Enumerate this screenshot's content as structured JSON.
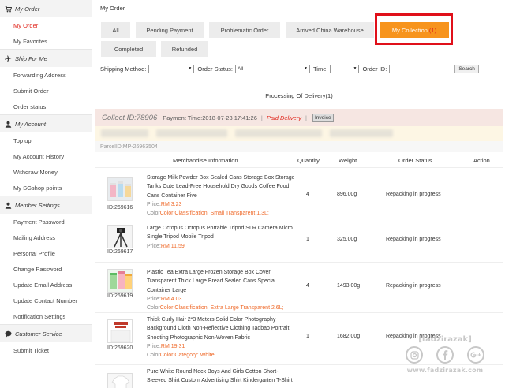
{
  "sidebar": {
    "sections": [
      {
        "heading": "My Order",
        "icon": "cart-icon",
        "items": [
          "My Order",
          "My Favorites"
        ]
      },
      {
        "heading": "Ship For Me",
        "icon": "plane-icon",
        "items": [
          "Forwarding Address",
          "Submit Order",
          "Order status"
        ]
      },
      {
        "heading": "My Account",
        "icon": "user-icon",
        "items": [
          "Top up",
          "My Account History",
          "Withdraw Money",
          "My SGshop points"
        ]
      },
      {
        "heading": "Member Settings",
        "icon": "user-icon",
        "items": [
          "Payment Password",
          "Mailing Address",
          "Personal Profile",
          "Change Password",
          "Update Email Address",
          "Update Contact Number",
          "Notification Settings"
        ]
      },
      {
        "heading": "Customer Service",
        "icon": "chat-icon",
        "items": [
          "Submit Ticket"
        ]
      }
    ]
  },
  "page": {
    "title": "My Order"
  },
  "tabs": [
    {
      "label": "All"
    },
    {
      "label": "Pending Payment"
    },
    {
      "label": "Problematic Order"
    },
    {
      "label": "Arrived China Warehouse"
    },
    {
      "label": "My Collection",
      "count": "(1)"
    },
    {
      "label": "Completed"
    },
    {
      "label": "Refunded"
    }
  ],
  "filters": {
    "shipping_label": "Shipping Method:",
    "shipping_value": "--",
    "status_label": "Order Status:",
    "status_value": "All",
    "time_label": "Time:",
    "time_value": "--",
    "orderid_label": "Order ID:",
    "search_label": "Search"
  },
  "processing_title": "Processing Of Delivery(1)",
  "collect": {
    "id": "Collect ID:78906",
    "payment_time": "Payment Time:2018-07-23 17:41:26",
    "separator": "|",
    "status": "Paid Delivery",
    "invoice_label": "Invoice",
    "parcel_id": "ParcelID:MP-26963504"
  },
  "table": {
    "headers": [
      "Merchandise Information",
      "Quantity",
      "Weight",
      "Order Status",
      "Action"
    ],
    "rows": [
      {
        "id": "ID:269616",
        "title": "Storage Milk Powder Box Sealed Cans Storage Box Storage Tanks Cute Lead-Free Household Dry Goods Coffee Food Cans Container Five",
        "price_label": "Price:",
        "price": "RM 3.23",
        "color_label": "Color",
        "color_value": "Color Classification: Small Transparent 1.3L;",
        "quantity": "4",
        "weight": "896.00g",
        "status": "Repacking in progress"
      },
      {
        "id": "ID:269617",
        "title": "Large Octopus Octopus Portable Tripod SLR Camera Micro Single Tripod Mobile Tripod",
        "price_label": "Price:",
        "price": "RM 11.59",
        "color_label": "",
        "color_value": "",
        "quantity": "1",
        "weight": "325.00g",
        "status": "Repacking in progress"
      },
      {
        "id": "ID:269619",
        "title": "Plastic Tea Extra Large Frozen Storage Box Cover Transparent Thick Large Bread Sealed Cans Special Container Large",
        "price_label": "Price:",
        "price": "RM 4.03",
        "color_label": "Color",
        "color_value": "Color Classification: Extra Large Transparent 2.6L;",
        "quantity": "4",
        "weight": "1493.00g",
        "status": "Repacking in progress"
      },
      {
        "id": "ID:269620",
        "title": "Thick Curly Hair 2*3 Meters Solid Color Photography Background Cloth Non-Reflective Clothing Taobao Portrait Shooting Photographic Non-Woven Fabric",
        "price_label": "Price:",
        "price": "RM 19.31",
        "color_label": "Color",
        "color_value": "Color Category: White;",
        "quantity": "1",
        "weight": "1682.00g",
        "status": "Repacking in progress"
      },
      {
        "id": "",
        "title": "Pure White Round Neck Boys And Girls Cotton Short-Sleeved Shirt Custom Advertising Shirt Kindergarten T-Shirt",
        "price_label": "",
        "price": "",
        "color_label": "",
        "color_value": "",
        "quantity": "",
        "weight": "",
        "status": ""
      }
    ]
  },
  "watermark": {
    "top": "[fadzirazak]",
    "bottom": "www.fadzirazak.com",
    "icons": [
      "instagram-icon",
      "facebook-icon",
      "google-plus-icon"
    ]
  },
  "colors": {
    "accent": "#f7941d",
    "red": "#e0251b",
    "price": "#ef6a2a",
    "highlight_outline": "#e0101a",
    "collect_bar": "#f6e6e2"
  }
}
